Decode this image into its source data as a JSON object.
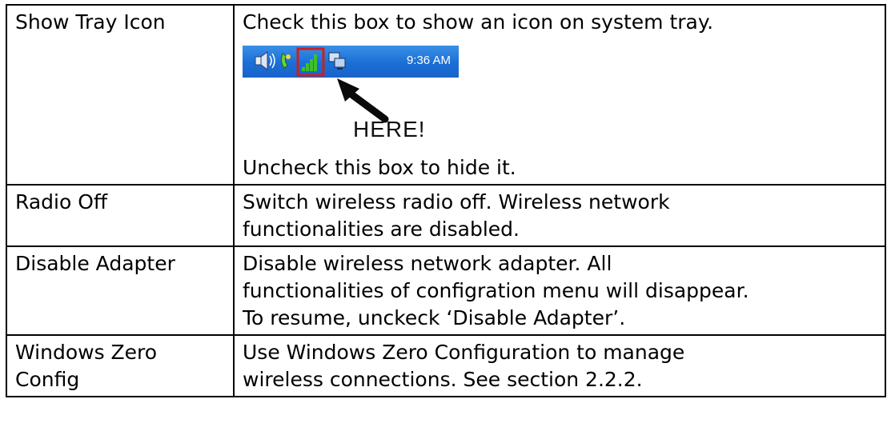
{
  "rows": [
    {
      "setting": "Show Tray Icon",
      "description_lines": [
        "Check this box to show an icon on system tray."
      ],
      "after_image_lines": [
        "Uncheck this box to hide it."
      ]
    },
    {
      "setting": "Radio Off",
      "description_lines": [
        "Switch wireless radio off. Wireless network",
        "functionalities are disabled."
      ]
    },
    {
      "setting": "Disable Adapter",
      "description_lines": [
        "Disable wireless network adapter. All",
        "functionalities of configration menu will disappear.",
        "To resume, unckeck ‘Disable Adapter’."
      ]
    },
    {
      "setting_lines": [
        "Windows Zero",
        "Config"
      ],
      "description_lines": [
        "Use Windows Zero Configuration to manage",
        "wireless connections. See section 2.2.2."
      ]
    }
  ],
  "tray_image": {
    "clock": "9:36 AM",
    "pointer_label": "HERE!",
    "icons": [
      "speaker-icon",
      "phone-icon",
      "signal-strength-icon",
      "network-computers-icon"
    ],
    "colors": {
      "taskbar": "#1a6fd6",
      "highlight_box": "#cc1f1f",
      "signal_bars": "#3fbf2f"
    }
  }
}
